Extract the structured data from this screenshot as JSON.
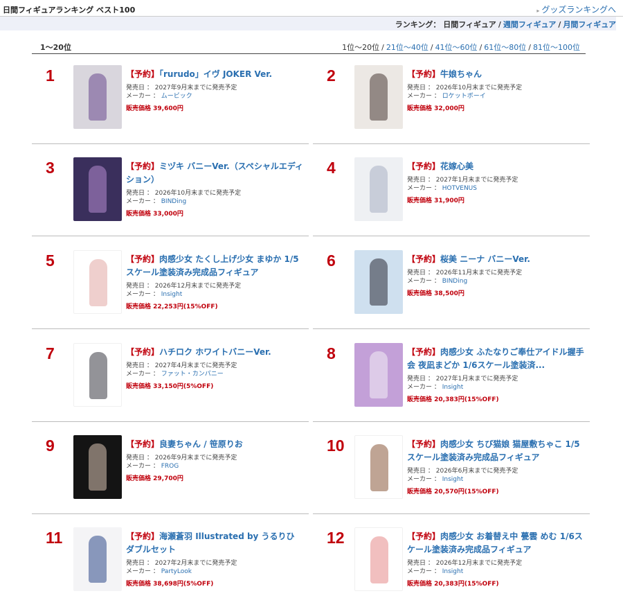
{
  "header": {
    "title": "日間フィギュアランキング ベスト100",
    "goods_link": "グッズランキングへ"
  },
  "tabs": {
    "prefix": "ランキング：",
    "current": "日間フィギュア",
    "weekly": "週間フィギュア",
    "monthly": "月間フィギュア",
    "sep": "/"
  },
  "range": {
    "label": "1〜20位",
    "current": "1位〜20位",
    "links": [
      "21位〜40位",
      "41位〜60位",
      "61位〜80位",
      "81位〜100位"
    ],
    "sep": "/"
  },
  "labels": {
    "reserve_tag": "【予約】",
    "release_prefix": "発売日 ：",
    "maker_prefix": "メーカー ：",
    "price_prefix": "販売価格"
  },
  "items": [
    {
      "rank": "1",
      "title": "「rurudo」イヴ JOKER Ver.",
      "release": "2027年9月末までに発売予定",
      "maker": "ムービック",
      "price": "39,600円",
      "bg": "#d9d6dd",
      "fig": "#6a4a8e"
    },
    {
      "rank": "2",
      "title": "牛娘ちゃん",
      "release": "2026年10月末までに発売予定",
      "maker": "ロケットボーイ",
      "price": "32,000円",
      "bg": "#ece8e4",
      "fig": "#4a3a36"
    },
    {
      "rank": "3",
      "title": "ミヅキ バニーVer.（スペシャルエディション）",
      "release": "2026年10月末までに発売予定",
      "maker": "BINDing",
      "price": "33,000円",
      "bg": "#3a2f5c",
      "fig": "#b58ad0"
    },
    {
      "rank": "4",
      "title": "花嫁心美",
      "release": "2027年1月末までに発売予定",
      "maker": "HOTVENUS",
      "price": "31,900円",
      "bg": "#eef0f3",
      "fig": "#a9b0c2"
    },
    {
      "rank": "5",
      "title": "肉感少女 たくし上げ少女 まゆか 1/5スケール塗装済み完成品フィギュア",
      "release": "2026年12月末までに発売予定",
      "maker": "Insight",
      "price": "22,253円(15%OFF)",
      "bg": "#ffffff",
      "fig": "#e2a7a4"
    },
    {
      "rank": "6",
      "title": "桜美 ニーナ バニーVer.",
      "release": "2026年11月末までに発売予定",
      "maker": "BINDing",
      "price": "38,500円",
      "bg": "#cfe0ef",
      "fig": "#2b2b36"
    },
    {
      "rank": "7",
      "title": "ハチロク ホワイトバニーVer.",
      "release": "2027年4月末までに発売予定",
      "maker": "ファット・カンパニー",
      "price": "33,150円(5%OFF)",
      "bg": "#ffffff",
      "fig": "#3a3a44"
    },
    {
      "rank": "8",
      "title": "肉感少女 ふたなりご奉仕アイドル握手会 夜凪まどか 1/6スケール塗装済...",
      "release": "2027年1月末までに発売予定",
      "maker": "Insight",
      "price": "20,383円(15%OFF)",
      "bg": "#c3a0d8",
      "fig": "#f2eef6"
    },
    {
      "rank": "9",
      "title": "良妻ちゃん / 笹原りお",
      "release": "2026年9月末までに発売予定",
      "maker": "FROG",
      "price": "29,700円",
      "bg": "#141414",
      "fig": "#d9c2b2"
    },
    {
      "rank": "10",
      "title": "肉感少女 ちび猫娘 猫屋敷ちゃこ 1/5スケール塗装済み完成品フィギュア",
      "release": "2026年6月末までに発売予定",
      "maker": "Insight",
      "price": "20,570円(15%OFF)",
      "bg": "#ffffff",
      "fig": "#8a5a3c"
    },
    {
      "rank": "11",
      "title": "海瀬蒼羽 Illustrated by うるりひ ダブルセット",
      "release": "2027年2月末までに発売予定",
      "maker": "PartyLook",
      "price": "38,698円(5%OFF)",
      "bg": "#f4f4f6",
      "fig": "#2f4a8a"
    },
    {
      "rank": "12",
      "title": "肉感少女 お着替え中 甍雲 めむ 1/6スケール塗装済み完成品フィギュア",
      "release": "2026年12月末までに発売予定",
      "maker": "Insight",
      "price": "20,383円(15%OFF)",
      "bg": "#ffffff",
      "fig": "#e68a8a"
    }
  ]
}
